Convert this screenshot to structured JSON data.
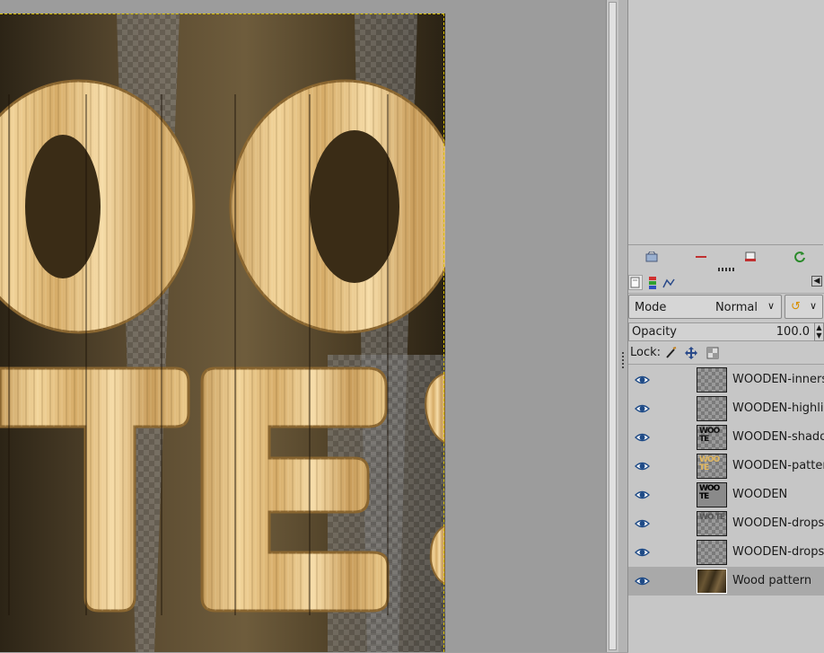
{
  "canvas": {
    "text_row1": "OOO",
    "text_row2": "TES"
  },
  "dock": {
    "top_buttons": [
      "new-channel-icon",
      "raise-lower-icon",
      "duplicate-icon",
      "refresh-icon"
    ],
    "tabs": [
      "layers-tab",
      "channels-tab",
      "paths-tab"
    ],
    "mode": {
      "label": "Mode",
      "value": "Normal"
    },
    "opacity": {
      "label": "Opacity",
      "value": "100.0"
    },
    "lock": {
      "label": "Lock:"
    },
    "layers": [
      {
        "name": "WOODEN-inners",
        "visible": true,
        "thumb": "transparent"
      },
      {
        "name": "WOODEN-highlig",
        "visible": true,
        "thumb": "transparent"
      },
      {
        "name": "WOODEN-shado",
        "visible": true,
        "thumb": "text",
        "thumb_text": "WOO TE"
      },
      {
        "name": "WOODEN-patter",
        "visible": true,
        "thumb": "pattern",
        "thumb_text": "WOO TE"
      },
      {
        "name": "WOODEN",
        "visible": true,
        "thumb": "solid-text",
        "thumb_text": "WOO TE"
      },
      {
        "name": "WOODEN-drops",
        "visible": true,
        "thumb": "text",
        "thumb_text": "WO TE"
      },
      {
        "name": "WOODEN-drops",
        "visible": true,
        "thumb": "transparent"
      },
      {
        "name": "Wood pattern",
        "visible": true,
        "thumb": "wood",
        "selected": true
      }
    ]
  },
  "colors": {
    "wood_light": "#e8c585",
    "wood_dark": "#6b4f22",
    "eye_blue": "#1e4a86",
    "selection_yellow": "#d8c000"
  }
}
